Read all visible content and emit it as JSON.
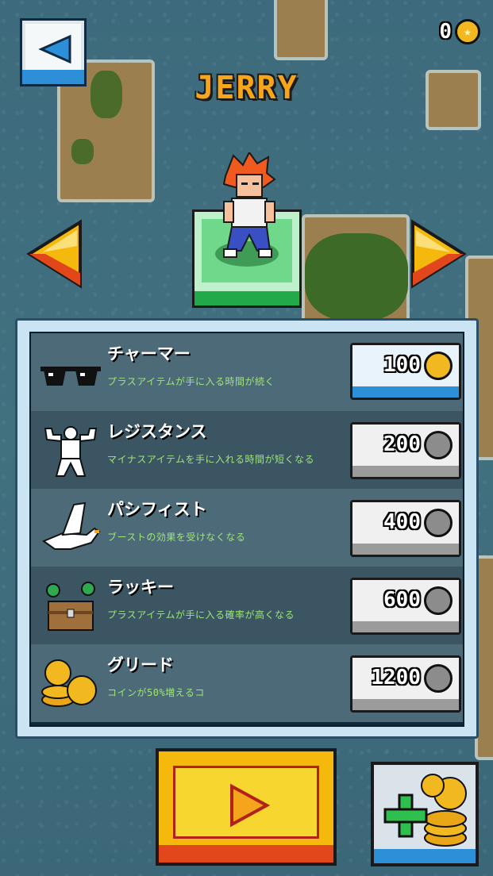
{
  "header": {
    "character_name": "JERRY",
    "coin_count": "0",
    "back_icon": "back-arrow-icon",
    "coin_icon": "gold-coin-icon"
  },
  "character": {
    "prev_icon": "prev-character-arrow-icon",
    "next_icon": "next-character-arrow-icon"
  },
  "shop": {
    "items": [
      {
        "name": "チャーマー",
        "desc": "プラスアイテムが手に入る時間が続く",
        "price": "100",
        "icon": "sunglasses-icon",
        "affordable": true
      },
      {
        "name": "レジスタンス",
        "desc": "マイナスアイテムを手に入れる時間が短くなる",
        "price": "200",
        "icon": "flexing-man-icon",
        "affordable": false
      },
      {
        "name": "パシフィスト",
        "desc": "ブーストの効果を受けなくなる",
        "price": "400",
        "icon": "dove-icon",
        "affordable": false
      },
      {
        "name": "ラッキー",
        "desc": "プラスアイテムが手に入る確率が高くなる",
        "price": "600",
        "icon": "clover-chest-icon",
        "affordable": false
      },
      {
        "name": "グリード",
        "desc": "コインが50%増えるコ",
        "price": "1200",
        "icon": "coin-stack-icon",
        "affordable": false
      }
    ]
  },
  "footer": {
    "play_icon": "play-icon",
    "add_coins_icon": "add-coins-icon"
  },
  "colors": {
    "water": "#3f6e80",
    "title": "#f7a51b",
    "accent_blue": "#2d8fd8",
    "desc_green": "#9de67a",
    "play_yellow": "#f5b80c"
  }
}
